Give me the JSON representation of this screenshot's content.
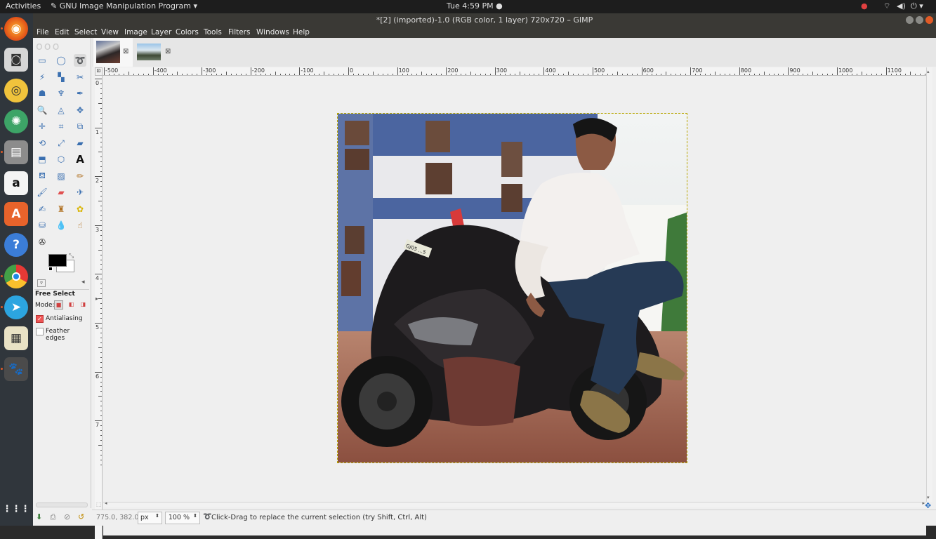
{
  "topbar": {
    "activities": "Activities",
    "app_name": "GNU Image Manipulation Program",
    "clock": "Tue  4:59 PM"
  },
  "window": {
    "title": "*[2] (imported)-1.0 (RGB color, 1 layer) 720x720 – GIMP"
  },
  "menu": [
    "File",
    "Edit",
    "Select",
    "View",
    "Image",
    "Layer",
    "Colors",
    "Tools",
    "Filters",
    "Windows",
    "Help"
  ],
  "launcher": [
    "firefox-icon",
    "camera-icon",
    "rhythmbox-icon",
    "network-icon",
    "files-icon",
    "amazon-icon",
    "software-center-icon",
    "help-icon",
    "chrome-icon",
    "telegram-icon",
    "document-viewer-icon",
    "gimp-icon"
  ],
  "tool_options": {
    "title": "Free Select",
    "mode_label": "Mode:",
    "antialiasing_label": "Antialiasing",
    "feather_label": "Feather edges"
  },
  "ruler": {
    "h_labels": [
      "-500",
      "-400",
      "-300",
      "-200",
      "-100",
      "0",
      "100",
      "200",
      "300",
      "400",
      "500",
      "600",
      "700",
      "800",
      "900",
      "1000",
      "1100"
    ],
    "v_labels": [
      "0",
      "1",
      "2",
      "3",
      "4",
      "5",
      "6",
      "7"
    ]
  },
  "status": {
    "coords": "775.0, 382.0",
    "unit": "px",
    "zoom": "100 %",
    "message": "Click-Drag to replace the current selection (try Shift, Ctrl, Alt)"
  },
  "colors": {
    "foreground": "#000000",
    "background": "#ffffff"
  },
  "photo": {
    "plate_text": "GJ05 ...5"
  }
}
